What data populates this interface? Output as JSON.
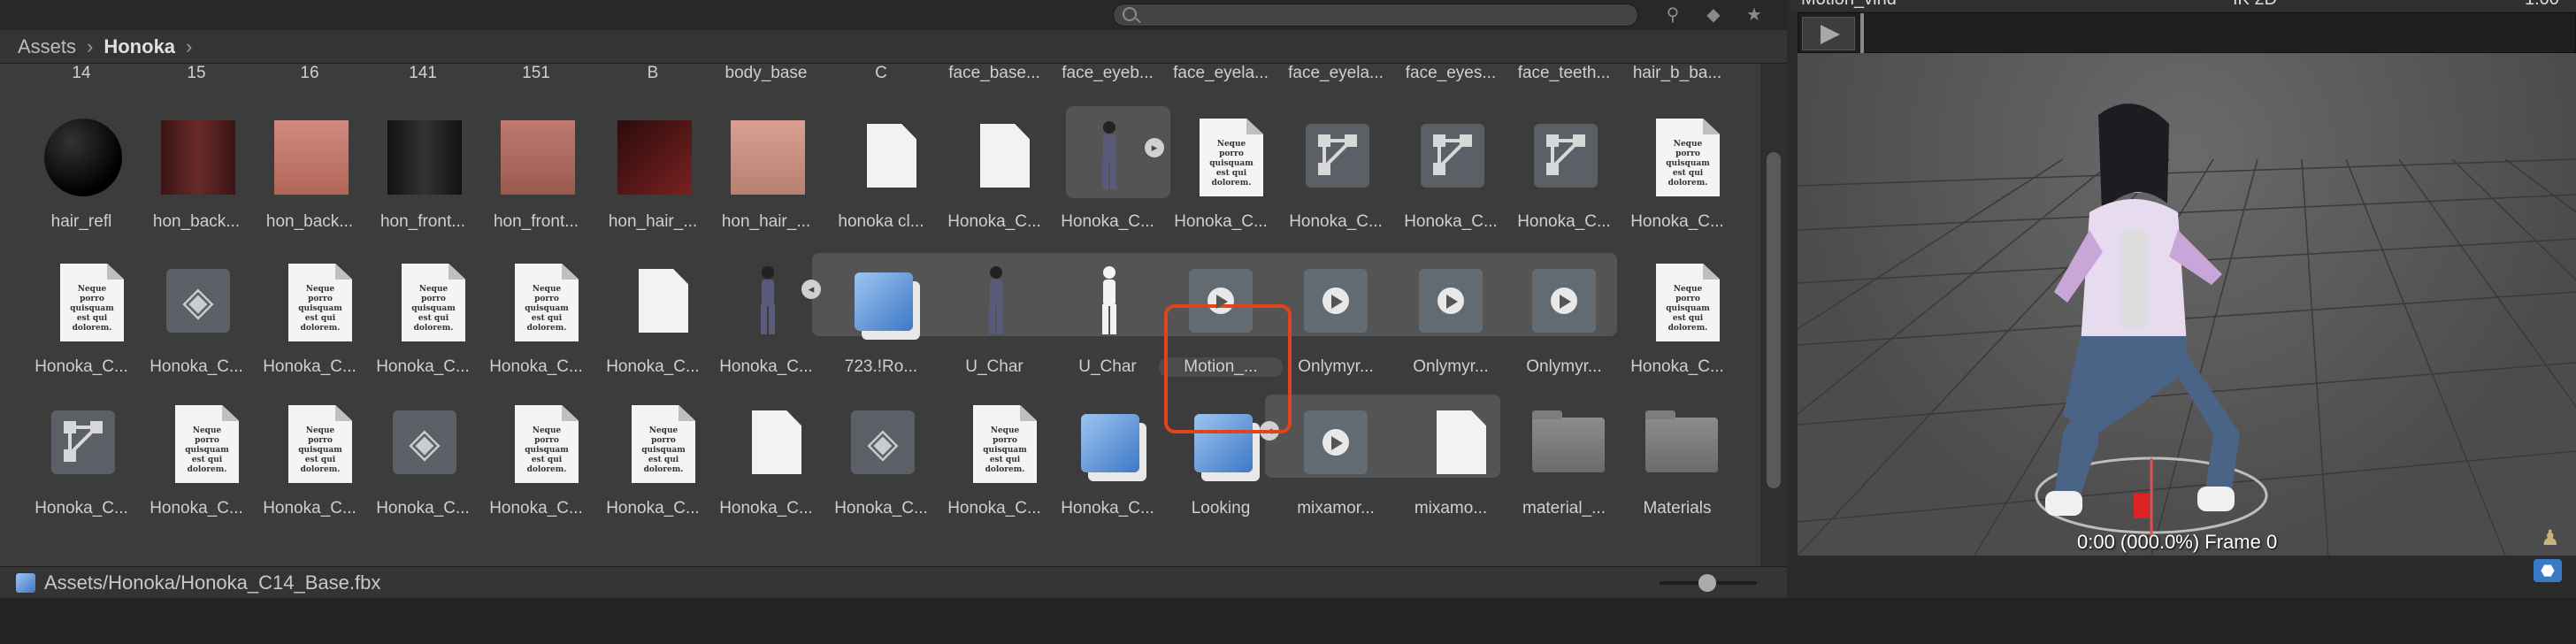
{
  "toolbar": {
    "search_placeholder": "",
    "icons": [
      "search-icon",
      "filter-by-type-icon",
      "filter-by-label-icon",
      "favorite-star-icon"
    ]
  },
  "breadcrumb": {
    "root": "Assets",
    "current": "Honoka"
  },
  "top_labels": [
    "14",
    "15",
    "16",
    "141",
    "151",
    "B",
    "body_base",
    "C",
    "face_base...",
    "face_eyeb...",
    "face_eyela...",
    "face_eyela...",
    "face_eyes...",
    "face_teeth...",
    "hair_b_ba..."
  ],
  "row1": [
    "hair_refl",
    "hon_back...",
    "hon_back...",
    "hon_front...",
    "hon_front...",
    "hon_hair_...",
    "hon_hair_...",
    "honoka cl...",
    "Honoka_C...",
    "Honoka_C...",
    "Honoka_C...",
    "Honoka_C...",
    "Honoka_C...",
    "Honoka_C...",
    "Honoka_C..."
  ],
  "row2": [
    "Honoka_C...",
    "Honoka_C...",
    "Honoka_C...",
    "Honoka_C...",
    "Honoka_C...",
    "Honoka_C...",
    "Honoka_C...",
    "723.!Ro...",
    "U_Char",
    "U_Char",
    "Motion_...",
    "Onlymyr...",
    "Onlymyr...",
    "Onlymyr...",
    "Honoka_C..."
  ],
  "row3": [
    "Honoka_C...",
    "Honoka_C...",
    "Honoka_C...",
    "Honoka_C...",
    "Honoka_C...",
    "Honoka_C...",
    "Honoka_C...",
    "Honoka_C...",
    "Honoka_C...",
    "Honoka_C...",
    "Looking",
    "mixamor...",
    "mixamo...",
    "material_...",
    "Materials"
  ],
  "doc_text": "Neque porro quisquam est qui dolorem.",
  "status": {
    "path": "Assets/Honoka/Honoka_C14_Base.fbx"
  },
  "preview": {
    "title": "Motion_vind",
    "ik_label": "IK   2D",
    "speed": "1.00",
    "frame_label": "0:00 (000.0%) Frame 0"
  },
  "colors": {
    "accent": "#e0441c",
    "panel": "#3c3c3c",
    "selected_blue": "#3a78c8"
  }
}
